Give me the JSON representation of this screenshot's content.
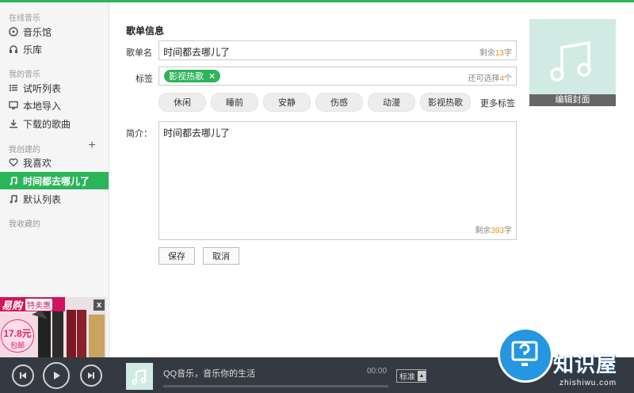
{
  "sidebar": {
    "online_section": "在线音乐",
    "online_items": [
      {
        "label": "音乐馆",
        "icon": "disc-icon"
      },
      {
        "label": "乐库",
        "icon": "headphones-icon"
      }
    ],
    "my_section": "我的音乐",
    "my_items": [
      {
        "label": "试听列表",
        "icon": "list-icon"
      },
      {
        "label": "本地导入",
        "icon": "monitor-icon"
      },
      {
        "label": "下载的歌曲",
        "icon": "download-icon"
      }
    ],
    "created_section": "我创建的",
    "created_items": [
      {
        "label": "我喜欢",
        "icon": "heart-icon"
      },
      {
        "label": "时间都去哪儿了",
        "icon": "music-note-icon",
        "active": true
      },
      {
        "label": "默认列表",
        "icon": "music-note-icon"
      }
    ],
    "collected_section": "我收藏的"
  },
  "ad": {
    "brand": "易购",
    "sub": "特卖惠",
    "price": "17.8元",
    "note": "包邮"
  },
  "form": {
    "title": "歌单信息",
    "name_label": "歌单名",
    "name_value": "时间都去哪儿了",
    "name_counter_prefix": "剩余",
    "name_counter_num": "13",
    "name_counter_suffix": "字",
    "tag_label": "标签",
    "selected_tag": "影视热歌",
    "tag_counter_prefix": "还可选择",
    "tag_counter_num": "4",
    "tag_counter_suffix": "个",
    "tag_options": [
      "休闲",
      "睡前",
      "安静",
      "伤感",
      "动漫",
      "影视热歌"
    ],
    "more_tags": "更多标签",
    "intro_label": "简介：",
    "intro_value": "时间都去哪儿了",
    "intro_counter_prefix": "剩余",
    "intro_counter_num": "393",
    "intro_counter_suffix": "字",
    "save": "保存",
    "cancel": "取消",
    "edit_cover": "编辑封面"
  },
  "player": {
    "track": "QQ音乐，音乐你的生活",
    "time": "00:00",
    "quality": "标准",
    "progress": 0
  },
  "watermark": {
    "brand": "知识屋",
    "url": "zhishiwu.com"
  },
  "colors": {
    "accent": "#2cb45a",
    "counter_number": "#f28c18",
    "player_bg": "#353a42",
    "cover_bg": "#d1ebe4"
  }
}
